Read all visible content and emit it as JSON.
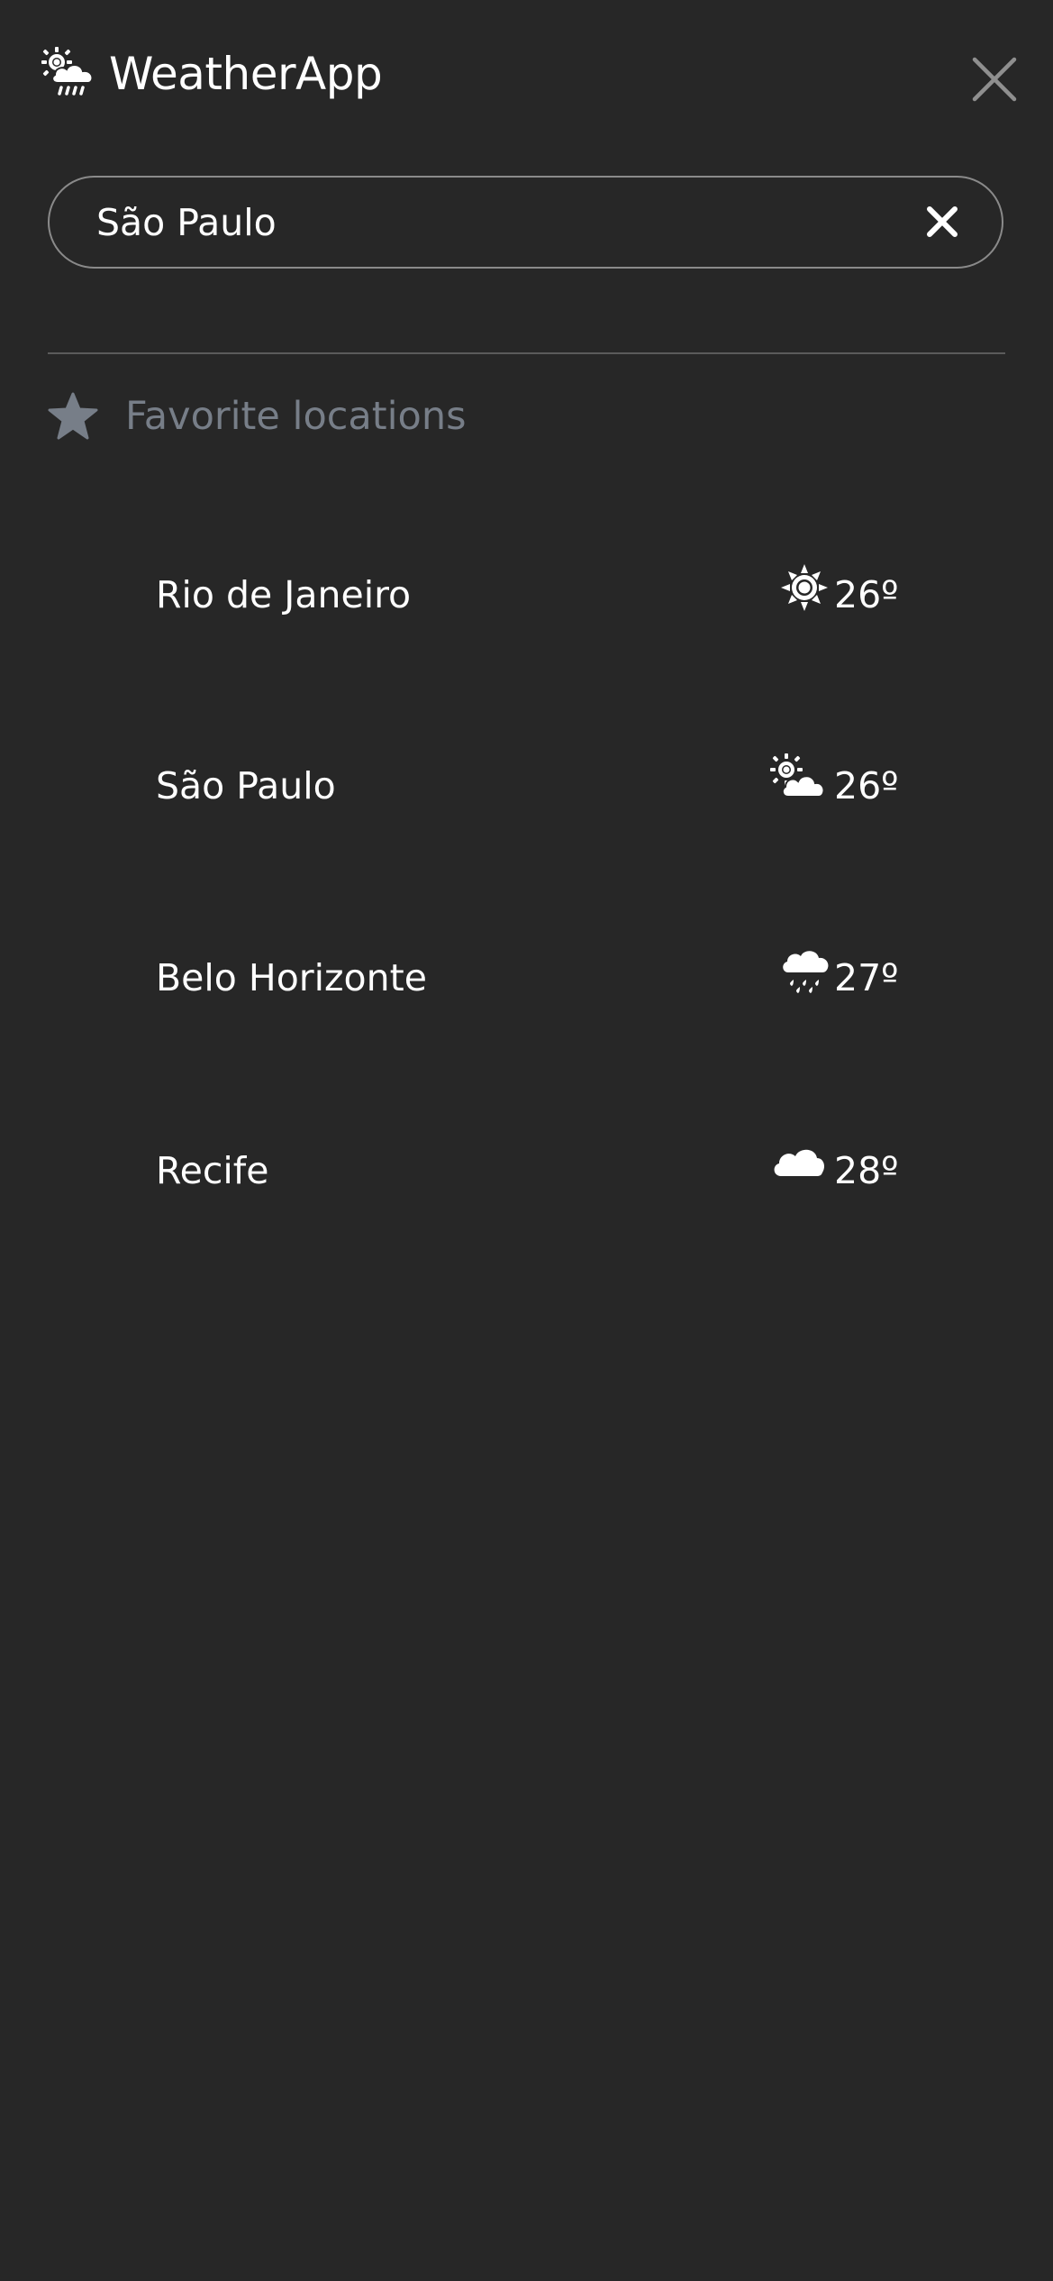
{
  "header": {
    "app_title": "WeatherApp",
    "logo_icon": "sun-cloud-rain-icon",
    "close_icon": "close-icon"
  },
  "search": {
    "value": "São Paulo",
    "clear_icon": "clear-icon"
  },
  "favorites": {
    "heading": "Favorite locations",
    "heading_icon": "star-icon",
    "items": [
      {
        "name": "Rio de Janeiro",
        "temperature": "26º",
        "icon": "sun-icon"
      },
      {
        "name": "São Paulo",
        "temperature": "26º",
        "icon": "partly-cloudy-icon"
      },
      {
        "name": "Belo Horizonte",
        "temperature": "27º",
        "icon": "rain-cloud-icon"
      },
      {
        "name": "Recife",
        "temperature": "28º",
        "icon": "cloud-icon"
      }
    ]
  },
  "colors": {
    "background": "#272727",
    "text": "#ffffff",
    "muted_text": "#777e88",
    "border": "#8a8a8a",
    "divider": "#5b5b5b"
  }
}
